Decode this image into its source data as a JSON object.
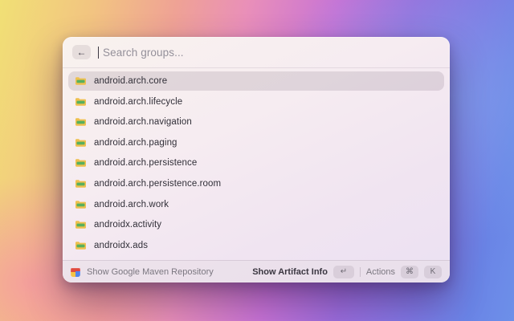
{
  "window": {
    "search": {
      "placeholder": "Search groups...",
      "back_icon": "←"
    },
    "list": {
      "selected_index": 0,
      "items": [
        {
          "label": "android.arch.core"
        },
        {
          "label": "android.arch.lifecycle"
        },
        {
          "label": "android.arch.navigation"
        },
        {
          "label": "android.arch.paging"
        },
        {
          "label": "android.arch.persistence"
        },
        {
          "label": "android.arch.persistence.room"
        },
        {
          "label": "android.arch.work"
        },
        {
          "label": "androidx.activity"
        },
        {
          "label": "androidx.ads"
        }
      ]
    },
    "footer": {
      "source_label": "Show Google Maven Repository",
      "primary_action": {
        "label": "Show Artifact Info",
        "key": "↵"
      },
      "secondary_action": {
        "label": "Actions",
        "keys": [
          "⌘",
          "K"
        ]
      }
    },
    "colors": {
      "folder_body": "#eec04e",
      "folder_band": "#57b05e",
      "maven_red": "#e0493f",
      "maven_yellow": "#f6c344",
      "maven_blue": "#5285ec",
      "selection": "rgba(104,86,104,0.16)"
    }
  }
}
